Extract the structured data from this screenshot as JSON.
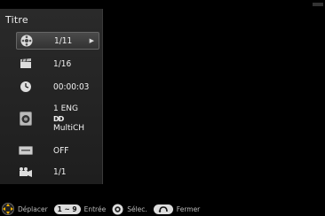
{
  "panel": {
    "title": "Titre",
    "rows": [
      {
        "icon": "disc-icon",
        "value": "1/11",
        "selected": true
      },
      {
        "icon": "clapperboard-icon",
        "value": "1/16"
      },
      {
        "icon": "clock-icon",
        "value": "00:00:03"
      },
      {
        "icon": "speaker-icon",
        "lines": [
          "1 ENG",
          "DD",
          "MultiCH"
        ]
      },
      {
        "icon": "subtitle-icon",
        "value": "OFF"
      },
      {
        "icon": "camera-angle-icon",
        "value": "1/1"
      }
    ]
  },
  "footer": {
    "move_label": "Déplacer",
    "range_chip": "1 ~ 9",
    "enter_label": "Entrée",
    "select_label": "Sélec.",
    "close_label": "Fermer"
  }
}
